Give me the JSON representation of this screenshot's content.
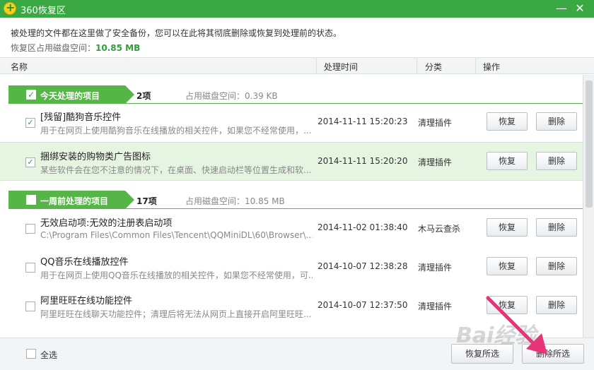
{
  "window": {
    "title": "360恢复区",
    "controls": [
      "—",
      "✕"
    ]
  },
  "info": {
    "line1": "被处理的文件都在这里做了安全备份，您可以在此将其彻底删除或恢复到处理前的状态。",
    "line2_label": "恢复区占用磁盘空间：",
    "line2_value": "10.85 MB"
  },
  "header": {
    "name": "名称",
    "time": "处理时间",
    "category": "分类",
    "action": "操作"
  },
  "groups": [
    {
      "title": "今天处理的项目",
      "checked": true,
      "count": "2项",
      "space": "占用磁盘空间：0.39 KB",
      "items": [
        {
          "checked": true,
          "name": "[残留]酷狗音乐控件",
          "desc": "用于在网页上使用酷狗音乐在线播放的相关控件，如果您不经常使用，...",
          "time": "2014-11-11 15:20:23",
          "category": "清理插件"
        },
        {
          "checked": true,
          "name": "捆绑安装的购物类广告图标",
          "desc": "某些软件会在您不注意的情况下，在桌面、快速启动栏等位置生成和软...",
          "time": "2014-11-11 15:20:20",
          "category": "清理插件"
        }
      ]
    },
    {
      "title": "一周前处理的项目",
      "checked": false,
      "count": "17项",
      "space": "占用磁盘空间：10.85 MB",
      "items": [
        {
          "checked": false,
          "name": "无效启动项:无效的注册表启动项",
          "desc": "C:\\Program Files\\Common Files\\Tencent\\QQMiniDL\\60\\Browser\\...",
          "time": "2014-11-02 01:38:40",
          "category": "木马云查杀"
        },
        {
          "checked": false,
          "name": "QQ音乐在线播放控件",
          "desc": "用于在网页上使用QQ音乐在线播放的相关控件，如果您不经常使用，可...",
          "time": "2014-10-07 12:38:28",
          "category": "清理插件"
        },
        {
          "checked": false,
          "name": "阿里旺旺在线功能控件",
          "desc": "阿里旺旺在线聊天功能控件；清理后将无法从网页上直接开启阿里旺旺...",
          "time": "2014-10-07 12:37:50",
          "category": "清理插件"
        }
      ]
    }
  ],
  "buttons": {
    "restore": "恢复",
    "delete": "删除",
    "restore_selected": "恢复所选",
    "delete_selected": "删除所选",
    "select_all": "全选"
  },
  "watermark": "Bai经验",
  "colors": {
    "brand_green": "#3aa843",
    "group_green": "#56b547",
    "annotation_arrow": "#e8337a"
  }
}
